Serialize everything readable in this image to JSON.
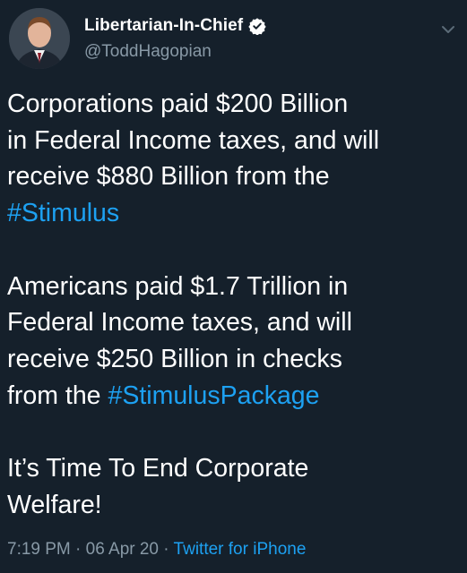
{
  "tweet": {
    "display_name": "Libertarian-In-Chief",
    "handle": "@ToddHagopian",
    "paragraphs": [
      {
        "lines": [
          {
            "text": "Corporations paid $200 Billion"
          },
          {
            "text": "in Federal Income taxes, and will"
          },
          {
            "text": "receive $880 Billion from the"
          },
          {
            "hashtag": "#Stimulus"
          }
        ]
      },
      {
        "lines": [
          {
            "text": "Americans paid $1.7 Trillion in"
          },
          {
            "text": "Federal Income taxes, and will"
          },
          {
            "text": "receive $250 Billion in checks"
          },
          {
            "text": "from the ",
            "hashtag": "#StimulusPackage"
          }
        ]
      },
      {
        "lines": [
          {
            "text": "It’s Time To End Corporate"
          },
          {
            "text": "Welfare!"
          }
        ]
      }
    ],
    "time": "7:19 PM",
    "separator": "·",
    "date": "06 Apr 20",
    "source": "Twitter for iPhone"
  },
  "colors": {
    "background": "#15202b",
    "text": "#ffffff",
    "secondary": "#8899a6",
    "accent": "#1da1f2"
  },
  "icons": {
    "verified": "verified-badge-icon",
    "menu": "chevron-down-icon"
  }
}
